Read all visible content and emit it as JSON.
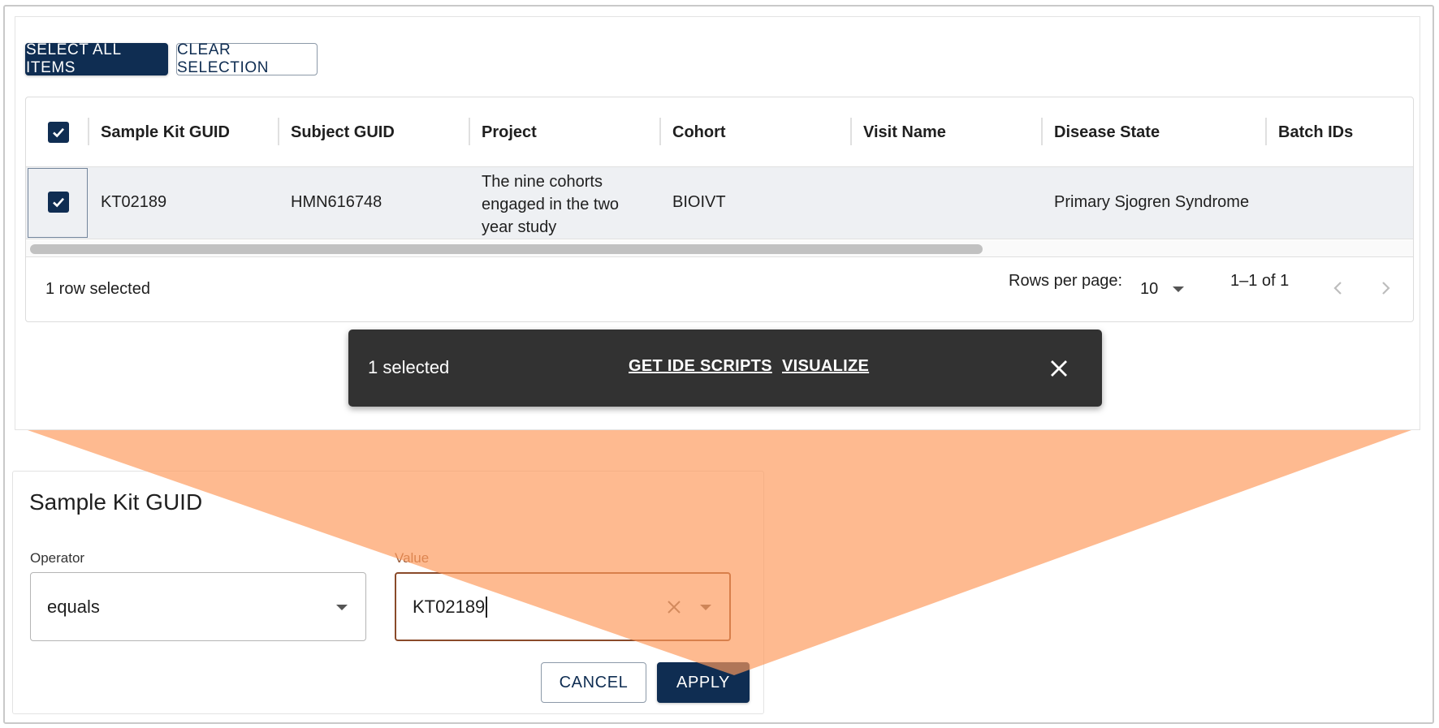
{
  "toolbar": {
    "select_all_label": "SELECT ALL ITEMS",
    "clear_selection_label": "CLEAR SELECTION"
  },
  "table": {
    "columns": [
      "Sample Kit GUID",
      "Subject GUID",
      "Project",
      "Cohort",
      "Visit Name",
      "Disease State",
      "Batch IDs"
    ],
    "rows": [
      {
        "selected": true,
        "sample_kit_guid": "KT02189",
        "subject_guid": "HMN616748",
        "project_line1": "The nine cohorts",
        "project_line2": "engaged in the two",
        "project_line3": "year study",
        "cohort": "BIOIVT",
        "visit_name": "",
        "disease_state": "Primary Sjogren Syndrome",
        "batch_ids": ""
      }
    ],
    "footer": {
      "selection_text": "1 row selected",
      "rows_per_page_label": "Rows per page:",
      "rows_per_page_value": "10",
      "pagination_text": "1–1 of 1"
    }
  },
  "snackbar": {
    "count_text": "1 selected",
    "action_ide_scripts": "GET IDE SCRIPTS",
    "action_visualize": "VISUALIZE"
  },
  "filter": {
    "title": "Sample Kit GUID",
    "operator_label": "Operator",
    "operator_value": "equals",
    "value_label": "Value",
    "value_input": "KT02189",
    "cancel_label": "CANCEL",
    "apply_label": "APPLY"
  },
  "colors": {
    "primary": "#0f2d52",
    "snackbar_bg": "#323232",
    "highlight_wedge": "#fdb98e",
    "focus_border": "#8a4a2a"
  },
  "icons": [
    "checkbox-checked-icon",
    "dropdown-arrow-icon",
    "chevron-left-icon",
    "chevron-right-icon",
    "close-icon",
    "clear-icon"
  ]
}
